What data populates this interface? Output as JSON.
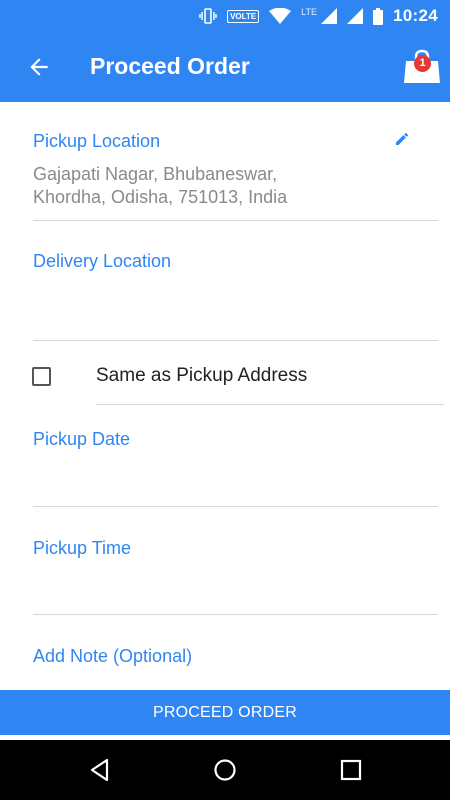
{
  "status_bar": {
    "time": "10:24",
    "volte": "VOLTE",
    "network": "LTE"
  },
  "app_bar": {
    "title": "Proceed Order",
    "cart_count": "1"
  },
  "form": {
    "pickup_location_label": "Pickup Location",
    "pickup_location_value_line1": "Gajapati Nagar, Bhubaneswar,",
    "pickup_location_value_line2": "Khordha, Odisha, 751013, India",
    "delivery_location_label": "Delivery Location",
    "same_as_pickup_label": "Same as Pickup Address",
    "same_as_pickup_checked": false,
    "pickup_date_label": "Pickup Date",
    "pickup_time_label": "Pickup Time",
    "add_note_label": "Add Note (Optional)"
  },
  "footer": {
    "proceed_button": "PROCEED ORDER"
  },
  "colors": {
    "primary": "#2f86f3",
    "badge": "#e53935"
  }
}
